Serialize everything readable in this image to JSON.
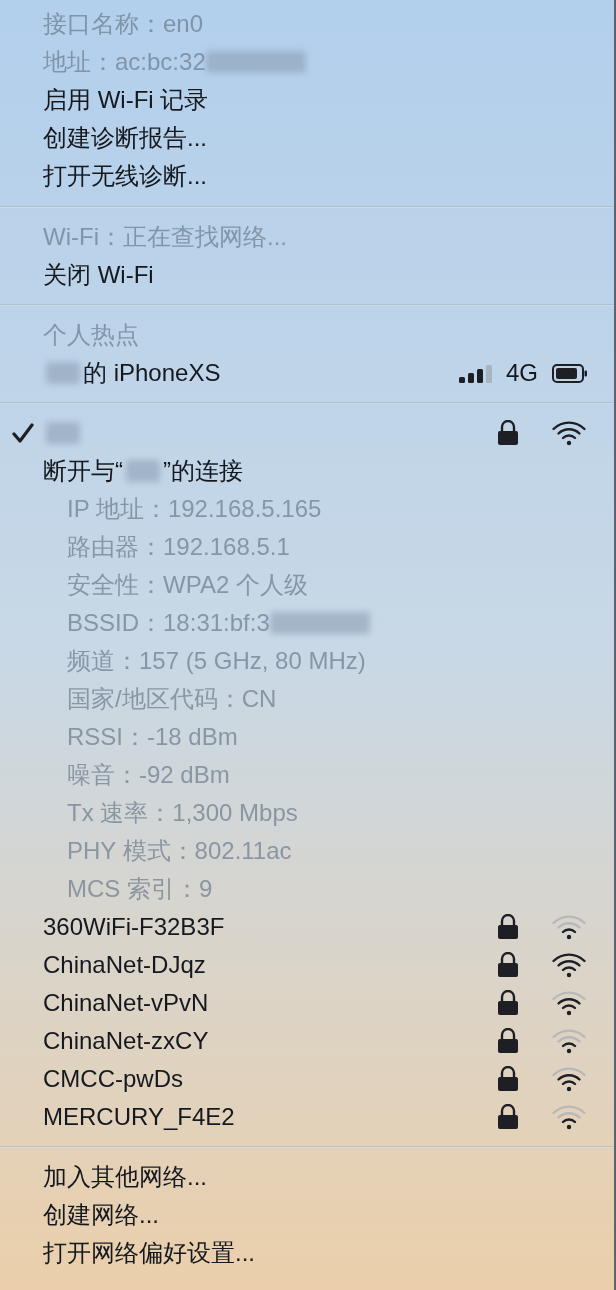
{
  "menu": {
    "sections": [
      {
        "items": [
          {
            "kind": "info",
            "label": "接口名称：en0"
          },
          {
            "kind": "info",
            "label": "地址：ac:bc:32",
            "redacted_end": true
          },
          {
            "kind": "action",
            "label": "启用 Wi-Fi 记录"
          },
          {
            "kind": "action",
            "label": "创建诊断报告..."
          },
          {
            "kind": "action",
            "label": "打开无线诊断..."
          }
        ]
      },
      {
        "items": [
          {
            "kind": "info",
            "label": "Wi-Fi：正在查找网络..."
          },
          {
            "kind": "action",
            "label": "关闭 Wi-Fi"
          }
        ]
      },
      {
        "items": [
          {
            "kind": "info",
            "label": "个人热点"
          },
          {
            "kind": "hotspot",
            "label": "的 iPhoneXS",
            "redacted_start": true,
            "full_signal": false,
            "network_type": "4G"
          }
        ]
      },
      {
        "items": [
          {
            "kind": "network",
            "selected": true,
            "locked": true,
            "full_signal": true,
            "redacted_start": true
          },
          {
            "kind": "action",
            "label": "断开与“",
            "redacted_middle": true,
            "label_end": "”的连接"
          },
          {
            "kind": "detail",
            "label": "IP 地址：192.168.5.165"
          },
          {
            "kind": "detail",
            "label": "路由器：192.168.5.1"
          },
          {
            "kind": "detail",
            "label": "安全性：WPA2 个人级"
          },
          {
            "kind": "detail",
            "label": "BSSID：18:31:bf:3",
            "redacted_end": true
          },
          {
            "kind": "detail",
            "label": "频道：157 (5 GHz, 80 MHz)"
          },
          {
            "kind": "detail",
            "label": "国家/地区代码：CN"
          },
          {
            "kind": "detail",
            "label": "RSSI：-18 dBm"
          },
          {
            "kind": "detail",
            "label": "噪音：-92 dBm"
          },
          {
            "kind": "detail",
            "label": "Tx 速率：1,300 Mbps"
          },
          {
            "kind": "detail",
            "label": "PHY 模式：802.11ac"
          },
          {
            "kind": "detail",
            "label": "MCS 索引：9"
          },
          {
            "kind": "network",
            "label": "360WiFi-F32B3F",
            "selected": false,
            "locked": true,
            "weak_signal": true
          },
          {
            "kind": "network",
            "label": "ChinaNet-DJqz",
            "selected": false,
            "locked": true,
            "full_signal": true
          },
          {
            "kind": "network",
            "label": "ChinaNet-vPvN",
            "selected": false,
            "locked": true,
            "weak_signal": false,
            "full_signal": false
          },
          {
            "kind": "network",
            "label": "ChinaNet-zxCY",
            "selected": false,
            "locked": true,
            "weak_signal": true
          },
          {
            "kind": "network",
            "label": "CMCC-pwDs",
            "selected": false,
            "locked": true,
            "weak_signal": false,
            "full_signal": false
          },
          {
            "kind": "network",
            "label": "MERCURY_F4E2",
            "selected": false,
            "locked": true,
            "weak_signal": true
          }
        ]
      },
      {
        "items": [
          {
            "kind": "action",
            "label": "加入其他网络..."
          },
          {
            "kind": "action",
            "label": "创建网络..."
          },
          {
            "kind": "action",
            "label": "打开网络偏好设置..."
          }
        ]
      }
    ]
  }
}
